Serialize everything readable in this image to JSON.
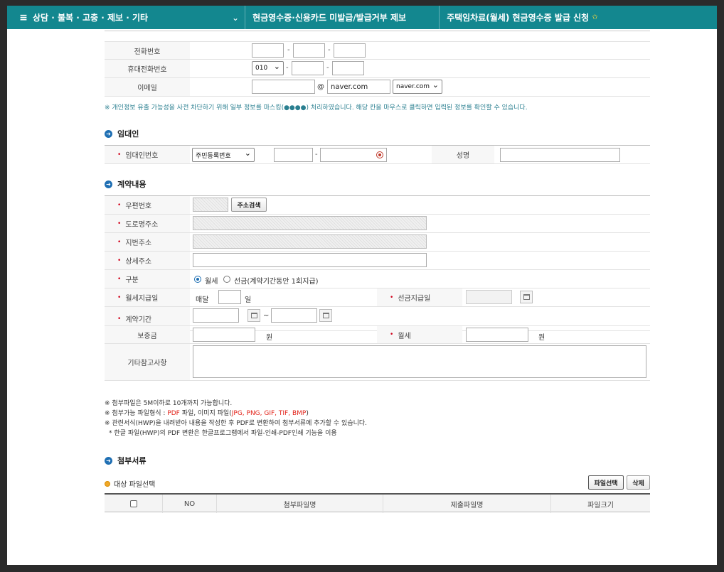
{
  "topbar": {
    "menu_label": "상담 · 불복 · 고충 · 제보 · 기타",
    "crumb2": "현금영수증·신용카드 미발급/발급거부 제보",
    "crumb3": "주택임차료(월세) 현금영수증 발급 신청",
    "star_color": "#ffd83a",
    "bar_color": "#13878f"
  },
  "contact": {
    "phone_label": "전화번호",
    "mobile_label": "휴대전화번호",
    "mobile_prefix": "010",
    "email_label": "이메일",
    "email_at": "@",
    "email_domain": "naver.com",
    "email_domain_select": "naver.com",
    "dash": "-"
  },
  "privacy_note": "※ 개인정보 유출 가능성을 사전 차단하기 위해 일부 정보를 마스킹(●●●●) 처리하였습니다. 해당 칸을 마우스로 클릭하면 입력된 정보를 확인할 수 있습니다.",
  "landlord": {
    "section_title": "임대인",
    "id_label": "임대인번호",
    "id_type": "주민등록번호",
    "name_label": "성명"
  },
  "contract": {
    "section_title": "계약내용",
    "zip_label": "우편번호",
    "zip_button": "주소검색",
    "road_label": "도로명주소",
    "lot_label": "지번주소",
    "detail_label": "상세주소",
    "type_label": "구분",
    "type_monthly": "월세",
    "type_prepaid": "선금(계약기간동안 1회지급)",
    "payday_label": "월세지급일",
    "payday_prefix": "매달",
    "payday_suffix": "일",
    "prepay_label": "선금지급일",
    "period_label": "계약기간",
    "period_sep": "~",
    "deposit_label": "보증금",
    "won": "원",
    "rent_label": "월세",
    "memo_label": "기타참고사항"
  },
  "attach_notes": {
    "n1": "※ 첨부파일은 5M이하로 10개까지 가능합니다.",
    "n2_prefix": "※ 첨부가능 파일형식 : ",
    "n2_pdf": "PDF",
    "n2_mid": " 파일, 이미지 파일(",
    "n2_img": "JPG, PNG, GIF, TIF, BMP",
    "n2_suffix": ")",
    "n3": "※ 관련서식(HWP)을 내려받아 내용을 작성한 후 PDF로 변환하여 첨부서류에 추가할 수 있습니다.",
    "n4": "* 한글 파일(HWP)의 PDF 변환은 한글프로그램에서 파일-인쇄-PDF인쇄 기능을 이용"
  },
  "attachments": {
    "section_title": "첨부서류",
    "target_label": "대상 파일선택",
    "select_button": "파일선택",
    "delete_button": "삭제",
    "columns": [
      "NO",
      "첨부파일명",
      "제출파일명",
      "파일크기"
    ]
  }
}
